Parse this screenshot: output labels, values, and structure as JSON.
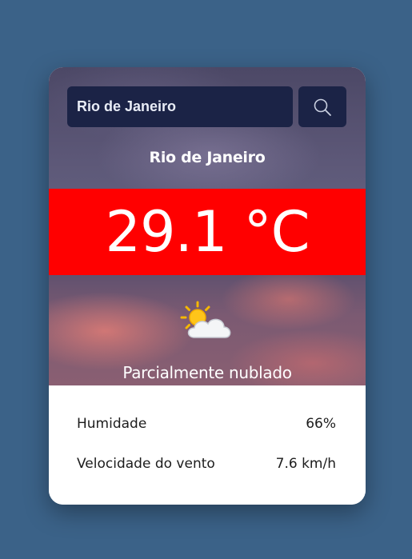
{
  "search": {
    "value": "Rio de Janeiro",
    "icon": "search-icon"
  },
  "weather": {
    "city": "Rio de Janeiro",
    "temperature": "29.1 °C",
    "icon": "partly-cloudy-icon",
    "condition": "Parcialmente nublado"
  },
  "details": {
    "humidity_label": "Humidade",
    "humidity_value": "66%",
    "wind_label": "Velocidade do vento",
    "wind_value": "7.6 km/h"
  },
  "colors": {
    "page_background": "#3b6288",
    "temperature_band": "#ff0000",
    "search_background": "#1b2346"
  }
}
